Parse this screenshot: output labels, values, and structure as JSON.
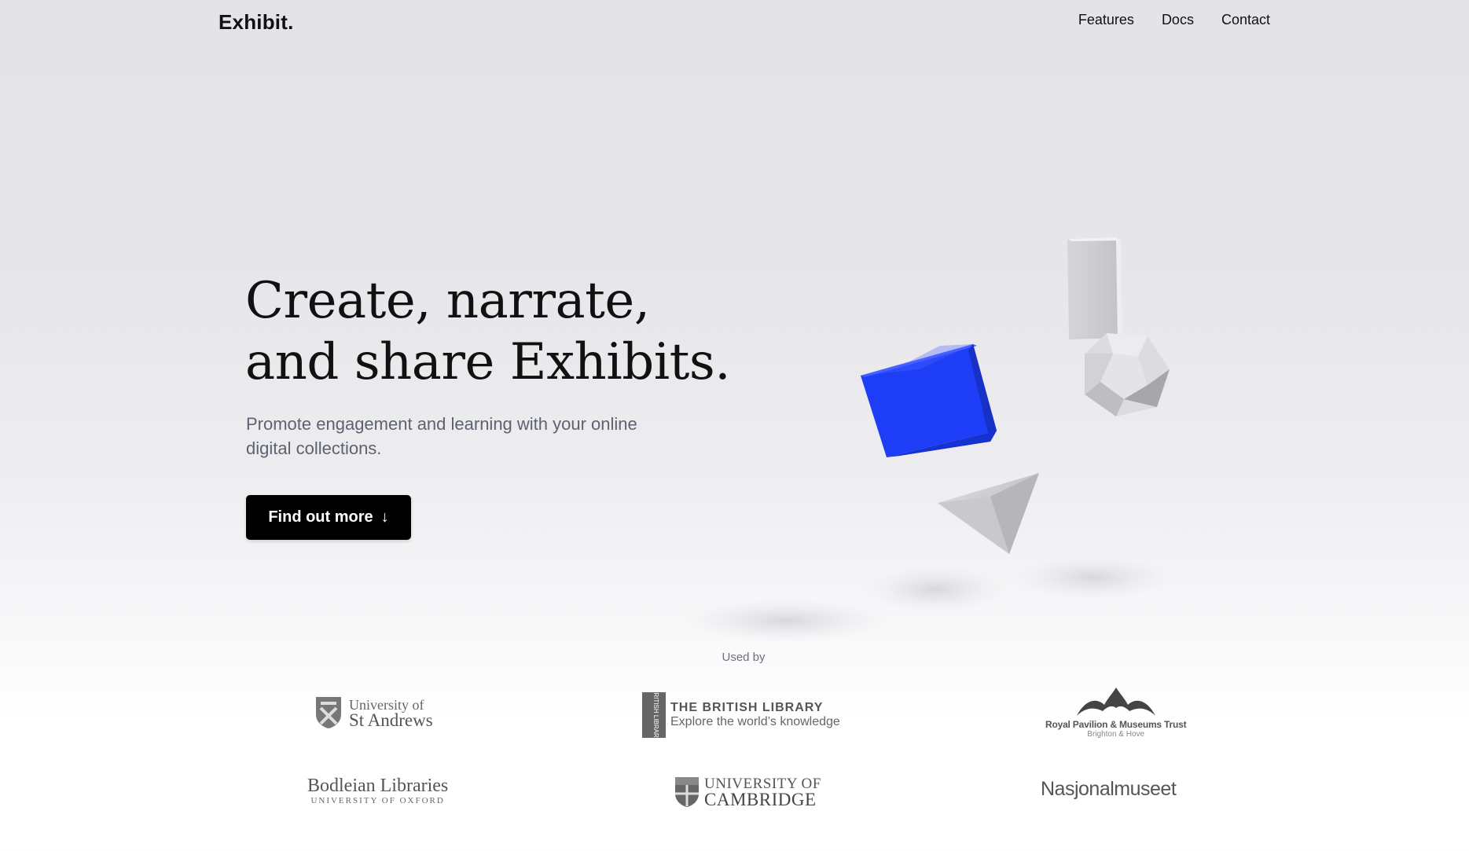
{
  "header": {
    "logo": "Exhibit.",
    "nav": [
      "Features",
      "Docs",
      "Contact"
    ]
  },
  "hero": {
    "title_line1": "Create, narrate,",
    "title_line2": "and share Exhibits.",
    "subtitle": "Promote engagement and learning with your online digital collections.",
    "cta_label": "Find out more",
    "cta_icon": "arrow-down-icon"
  },
  "used_by": {
    "label": "Used by",
    "logos": {
      "st_andrews": {
        "line1": "University of",
        "line2": "St Andrews"
      },
      "british_library": {
        "badge": "BRITISH LIBRARY",
        "line1": "THE BRITISH LIBRARY",
        "line2": "Explore the world’s knowledge"
      },
      "royal_pavilion": {
        "line1": "Royal Pavilion & Museums Trust",
        "line2": "Brighton & Hove"
      },
      "bodleian": {
        "line1": "Bodleian Libraries",
        "line2": "UNIVERSITY OF OXFORD"
      },
      "cambridge": {
        "line1": "UNIVERSITY OF",
        "line2": "CAMBRIDGE"
      },
      "nasjonalmuseet": {
        "name": "Nasjonalmuseet"
      }
    }
  },
  "colors": {
    "accent_cube": "#1b3cff",
    "button_bg": "#000000",
    "button_text": "#ffffff"
  }
}
